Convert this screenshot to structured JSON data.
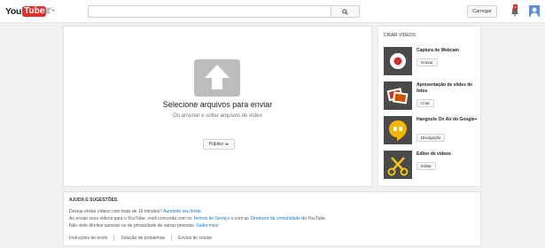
{
  "header": {
    "logo_you": "You",
    "logo_tube": "Tube",
    "logo_region": "BR",
    "search_placeholder": "",
    "upload_label": "Carregar",
    "notification_count": "1"
  },
  "upload": {
    "title": "Selecione arquivos para enviar",
    "subtitle": "Ou arrastar e soltar arquivos de vídeo",
    "privacy_label": "Público"
  },
  "create": {
    "title": "CRIAR VÍDEOS",
    "items": [
      {
        "label": "Captura de Webcam",
        "button": "Gravar"
      },
      {
        "label": "Apresentação de slides de fotos",
        "button": "Criar"
      },
      {
        "label": "Hangouts On Air do Google+",
        "button": "Divulgação"
      },
      {
        "label": "Editor de vídeos",
        "button": "Editar"
      }
    ]
  },
  "help": {
    "title": "AJUDA E SUGESTÕES",
    "line1_text": "Deseja enviar vídeos com mais de 15 minutos?",
    "line1_link": "Aumente seu limite.",
    "line2_a": "Ao enviar seus vídeos para o YouTube, você concorda com os",
    "line2_link1": "Termos de Serviço",
    "line2_b": "e com as",
    "line2_link2": "Diretrizes da comunidade",
    "line2_c": "do YouTube.",
    "line3_text": "Não viole direitos autorais ou de privacidade de outras pessoas.",
    "line3_link": "Saiba mais",
    "links": [
      "Instruções de envio",
      "Solução de problemas",
      "Envios do celular"
    ]
  },
  "colors": {
    "brand_red": "#e52d27",
    "link_blue": "#167ac6"
  }
}
